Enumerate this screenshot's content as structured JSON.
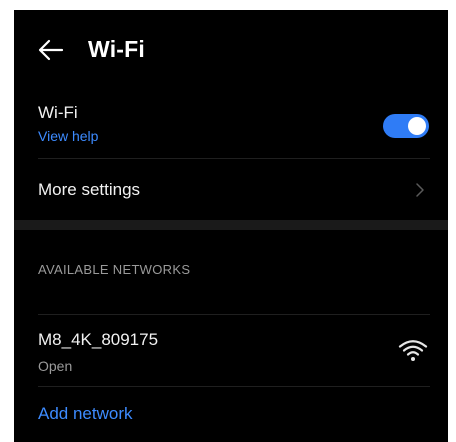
{
  "header": {
    "title": "Wi-Fi",
    "back_icon": "arrow-left-icon"
  },
  "wifi_row": {
    "title": "Wi-Fi",
    "help_link": "View help",
    "toggle_on": true
  },
  "more_settings": {
    "label": "More settings",
    "icon": "chevron-right-icon"
  },
  "available_networks": {
    "section_label": "AVAILABLE NETWORKS",
    "networks": [
      {
        "ssid": "M8_4K_809175",
        "status": "Open",
        "signal_icon": "wifi-signal-icon"
      }
    ]
  },
  "add_network": {
    "label": "Add network"
  },
  "colors": {
    "background": "#000000",
    "accent": "#2f7cf6",
    "link": "#3d8bff",
    "text_primary": "#f2f2f2",
    "text_secondary": "#9a9a9a"
  }
}
